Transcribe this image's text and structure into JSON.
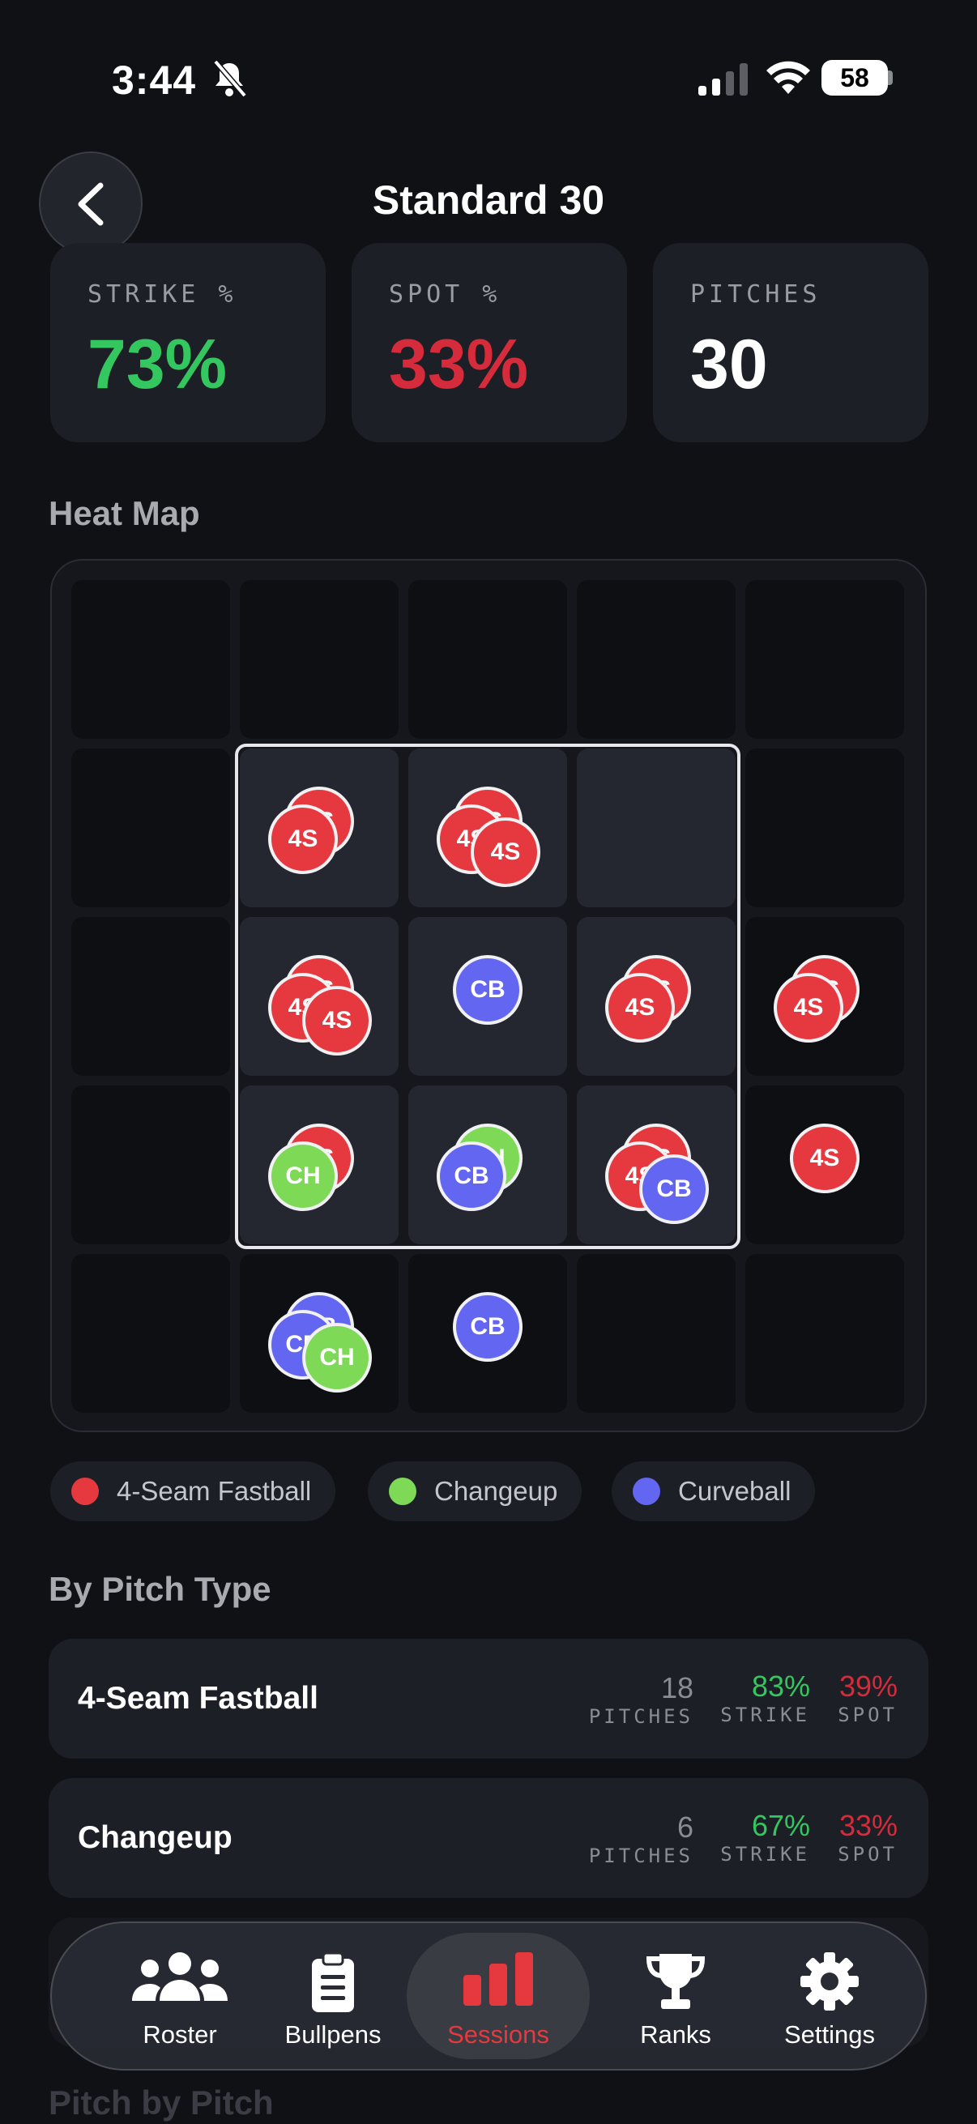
{
  "status_bar": {
    "time": "3:44",
    "battery": "58"
  },
  "header": {
    "title": "Standard 30"
  },
  "stats": [
    {
      "label": "STRIKE %",
      "value": "73%",
      "color": "#34c65f"
    },
    {
      "label": "SPOT %",
      "value": "33%",
      "color": "#d52b3a"
    },
    {
      "label": "PITCHES",
      "value": "30",
      "color": "#ffffff"
    }
  ],
  "heat_map": {
    "title": "Heat Map",
    "pitches": [
      {
        "code": "4S",
        "col": 1,
        "row": 1
      },
      {
        "code": "4S",
        "col": 1,
        "row": 1
      },
      {
        "code": "4S",
        "col": 2,
        "row": 1
      },
      {
        "code": "4S",
        "col": 2,
        "row": 1
      },
      {
        "code": "4S",
        "col": 2,
        "row": 1
      },
      {
        "code": "4S",
        "col": 1,
        "row": 2
      },
      {
        "code": "4S",
        "col": 1,
        "row": 2
      },
      {
        "code": "4S",
        "col": 1,
        "row": 2
      },
      {
        "code": "CB",
        "col": 2,
        "row": 2
      },
      {
        "code": "4S",
        "col": 3,
        "row": 2
      },
      {
        "code": "4S",
        "col": 3,
        "row": 2
      },
      {
        "code": "4S",
        "col": 4,
        "row": 2
      },
      {
        "code": "4S",
        "col": 4,
        "row": 2
      },
      {
        "code": "4S",
        "col": 1,
        "row": 3
      },
      {
        "code": "CH",
        "col": 1,
        "row": 3
      },
      {
        "code": "CH",
        "col": 2,
        "row": 3
      },
      {
        "code": "CB",
        "col": 2,
        "row": 3
      },
      {
        "code": "4S",
        "col": 3,
        "row": 3
      },
      {
        "code": "4S",
        "col": 3,
        "row": 3
      },
      {
        "code": "CB",
        "col": 3,
        "row": 3
      },
      {
        "code": "4S",
        "col": 4,
        "row": 3
      },
      {
        "code": "CB",
        "col": 1,
        "row": 4
      },
      {
        "code": "CB",
        "col": 1,
        "row": 4
      },
      {
        "code": "CH",
        "col": 1,
        "row": 4
      },
      {
        "code": "CB",
        "col": 2,
        "row": 4
      }
    ]
  },
  "legend": [
    {
      "label": "4-Seam Fastball",
      "color": "#e5393f"
    },
    {
      "label": "Changeup",
      "color": "#7ed957"
    },
    {
      "label": "Curveball",
      "color": "#6366f1"
    }
  ],
  "pitch_colors": {
    "4S": "#e5393f",
    "CH": "#7ed957",
    "CB": "#6366f1"
  },
  "by_pitch_type": {
    "title": "By Pitch Type",
    "pitches_label": "PITCHES",
    "strike_label": "STRIKE",
    "spot_label": "SPOT",
    "rows": [
      {
        "name": "4-Seam Fastball",
        "pitches": "18",
        "strike": "83%",
        "spot": "39%"
      },
      {
        "name": "Changeup",
        "pitches": "6",
        "strike": "67%",
        "spot": "33%"
      }
    ]
  },
  "next_section": {
    "title": "Pitch by Pitch"
  },
  "nav": [
    {
      "label": "Roster",
      "icon": "users-icon"
    },
    {
      "label": "Bullpens",
      "icon": "clipboard-icon"
    },
    {
      "label": "Sessions",
      "icon": "bar-chart-icon",
      "active": true,
      "active_color": "#e5393f"
    },
    {
      "label": "Ranks",
      "icon": "trophy-icon"
    },
    {
      "label": "Settings",
      "icon": "gear-icon"
    }
  ]
}
